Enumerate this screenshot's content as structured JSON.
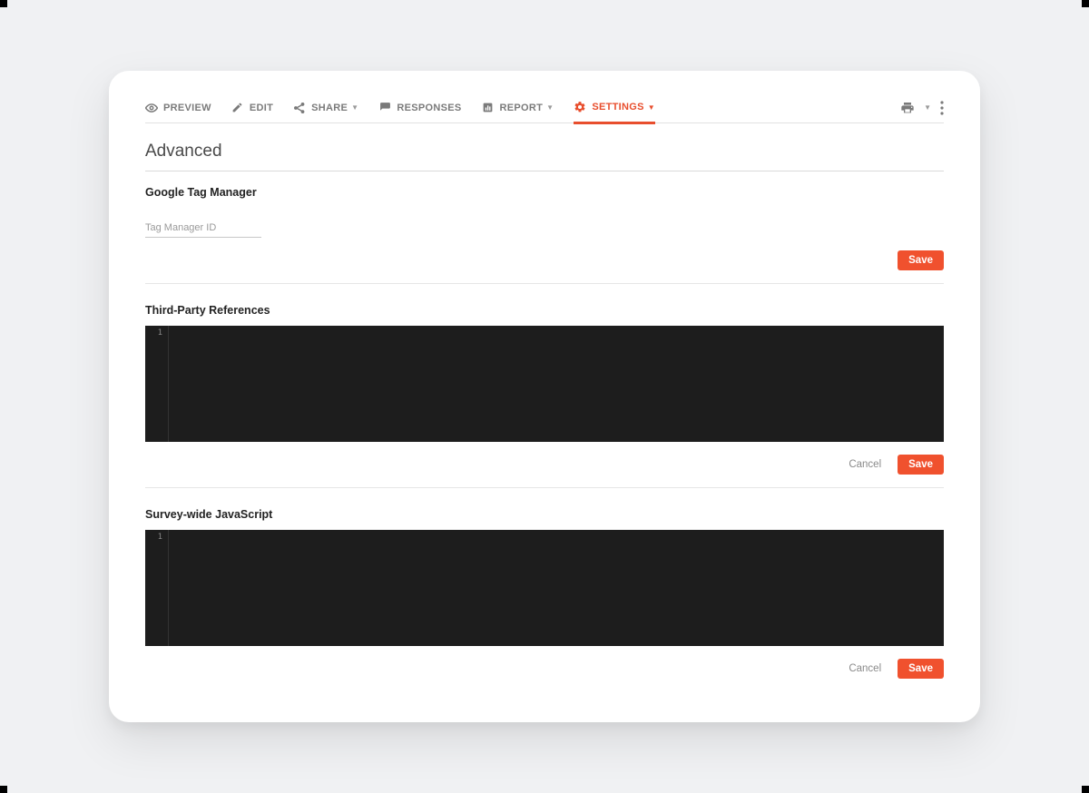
{
  "toolbar": {
    "preview": "PREVIEW",
    "edit": "EDIT",
    "share": "SHARE",
    "responses": "RESPONSES",
    "report": "REPORT",
    "settings": "SETTINGS"
  },
  "page": {
    "title": "Advanced"
  },
  "gtm": {
    "title": "Google Tag Manager",
    "placeholder": "Tag Manager ID",
    "value": "",
    "save": "Save"
  },
  "third_party": {
    "title": "Third-Party References",
    "line_number": "1",
    "content": "",
    "cancel": "Cancel",
    "save": "Save"
  },
  "survey_js": {
    "title": "Survey-wide JavaScript",
    "line_number": "1",
    "content": "",
    "cancel": "Cancel",
    "save": "Save"
  },
  "colors": {
    "accent": "#e84e2d",
    "save_button": "#f0512e",
    "editor_bg": "#1d1d1d"
  }
}
